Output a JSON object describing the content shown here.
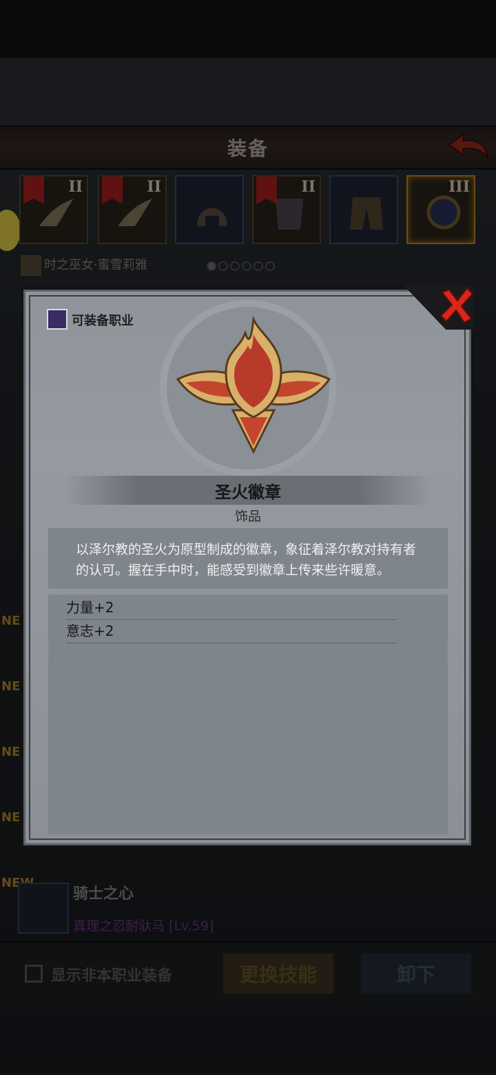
{
  "header": {
    "title": "装备"
  },
  "slots": [
    {
      "tier": "II",
      "item": "weapon-claw",
      "border": "bronze"
    },
    {
      "tier": "II",
      "item": "weapon-claw",
      "border": "bronze"
    },
    {
      "tier": "",
      "item": "helmet",
      "border": "blue"
    },
    {
      "tier": "II",
      "item": "armor",
      "border": "bronze"
    },
    {
      "tier": "",
      "item": "pants",
      "border": "blue"
    },
    {
      "tier": "III",
      "item": "orb-accessory",
      "border": "gold"
    }
  ],
  "character": {
    "name": "时之巫女·蜜雪莉雅",
    "page_dots": 6,
    "active_dot": 0
  },
  "list": {
    "new_tags": [
      "NE",
      "NE",
      "NE",
      "NE",
      "NEW"
    ],
    "item": {
      "name": "骑士之心",
      "owner": "真理之忍耐驮马 [Lv.59]"
    }
  },
  "bottom": {
    "checkbox_label": "显示非本职业装备",
    "skill_button": "更换技能",
    "unequip_button": "卸下"
  },
  "modal": {
    "job_label": "可装备职业",
    "item_name": "圣火徽章",
    "item_type": "饰品",
    "description": "以泽尔教的圣火为原型制成的徽章，象征着泽尔教对持有者的认可。握在手中时，能感受到徽章上传来些许暖意。",
    "stats": [
      "力量+2",
      "意志+2"
    ]
  },
  "colors": {
    "modal_bg": "#959aa0",
    "close_red": "#d9261c",
    "owner_purple": "#6d3a86"
  }
}
